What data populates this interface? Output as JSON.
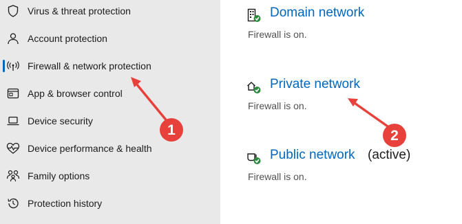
{
  "sidebar": {
    "items": [
      {
        "label": "Virus & threat protection",
        "icon": "shield-icon"
      },
      {
        "label": "Account protection",
        "icon": "person-icon"
      },
      {
        "label": "Firewall & network protection",
        "icon": "wifi-antenna-icon",
        "selected": true
      },
      {
        "label": "App & browser control",
        "icon": "app-window-icon"
      },
      {
        "label": "Device security",
        "icon": "laptop-icon"
      },
      {
        "label": "Device performance & health",
        "icon": "heart-pulse-icon"
      },
      {
        "label": "Family options",
        "icon": "family-icon"
      },
      {
        "label": "Protection history",
        "icon": "history-icon"
      }
    ]
  },
  "networks": [
    {
      "title": "Domain network",
      "status": "Firewall is on.",
      "icon": "domain-building-icon",
      "active": ""
    },
    {
      "title": "Private network",
      "status": "Firewall is on.",
      "icon": "private-home-icon",
      "active": ""
    },
    {
      "title": "Public network",
      "status": "Firewall is on.",
      "icon": "public-coffee-icon",
      "active": "(active)"
    }
  ],
  "annotations": {
    "marker1": "1",
    "marker2": "2",
    "color": "#e8413b"
  },
  "colors": {
    "accent": "#0067c0",
    "sidebar_bg": "#e9e9e9",
    "check_green": "#2b8a3e"
  }
}
